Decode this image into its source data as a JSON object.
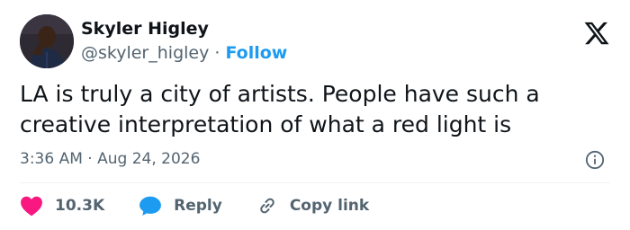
{
  "author": {
    "name": "Skyler Higley",
    "handle": "@skyler_higley",
    "separator": " · ",
    "follow_label": "Follow"
  },
  "tweet": {
    "text": "LA is truly a city of artists. People have such a creative interpretation of what a red light is",
    "time": "3:36 AM",
    "date_separator": " · ",
    "date": "Aug 24, 2026"
  },
  "actions": {
    "likes_count": "10.3K",
    "reply_label": "Reply",
    "copy_link_label": "Copy link"
  },
  "icons": {
    "brand": "x-logo-icon",
    "info": "info-icon",
    "like": "heart-icon",
    "reply": "speech-bubble-icon",
    "copy_link": "link-icon"
  },
  "colors": {
    "follow": "#1d9bf0",
    "heart": "#f91880",
    "reply_bubble": "#1d9bf0",
    "secondary_text": "#536471",
    "primary_text": "#0f1419"
  }
}
